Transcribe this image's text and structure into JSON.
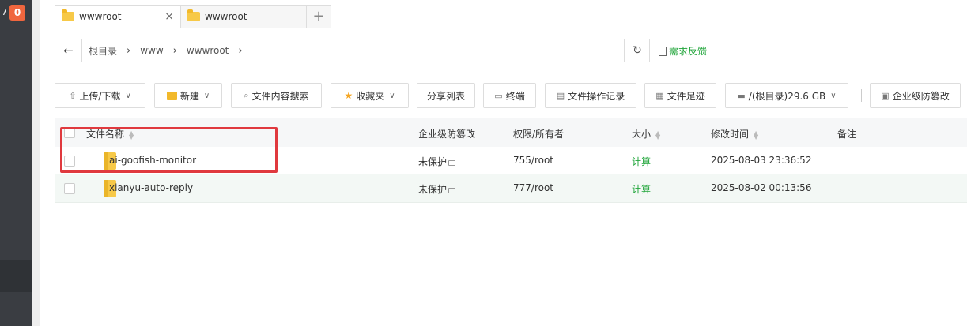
{
  "sidebar": {
    "number": "7",
    "badge": "0"
  },
  "tabs": [
    {
      "label": "wwwroot",
      "close": "×"
    },
    {
      "label": "wwwroot"
    }
  ],
  "tab_add": "+",
  "address": {
    "back": "←",
    "crumbs": [
      "根目录",
      "www",
      "wwwroot"
    ],
    "sep": "›",
    "refresh": "↻"
  },
  "feedback": "需求反馈",
  "toolbar": {
    "upload": "上传/下载",
    "new": "新建",
    "search": "文件内容搜索",
    "favorites": "收藏夹",
    "share": "分享列表",
    "terminal": "终端",
    "oplog": "文件操作记录",
    "footprint": "文件足迹",
    "disk": "/(根目录)29.6 GB",
    "enterprise": "企业级防篡改"
  },
  "table": {
    "headers": {
      "name": "文件名称",
      "tamper": "企业级防篡改",
      "perm": "权限/所有者",
      "size": "大小",
      "mtime": "修改时间",
      "note": "备注"
    },
    "rows": [
      {
        "name": "ai-goofish-monitor",
        "tamper": "未保护",
        "perm": "755/root",
        "size": "计算",
        "mtime": "2025-08-03 23:36:52"
      },
      {
        "name": "xianyu-auto-reply",
        "tamper": "未保护",
        "perm": "777/root",
        "size": "计算",
        "mtime": "2025-08-02 00:13:56"
      }
    ]
  },
  "colors": {
    "accent": "#20a53a",
    "highlight": "#e0393e",
    "sidebar": "#3a3d42"
  }
}
